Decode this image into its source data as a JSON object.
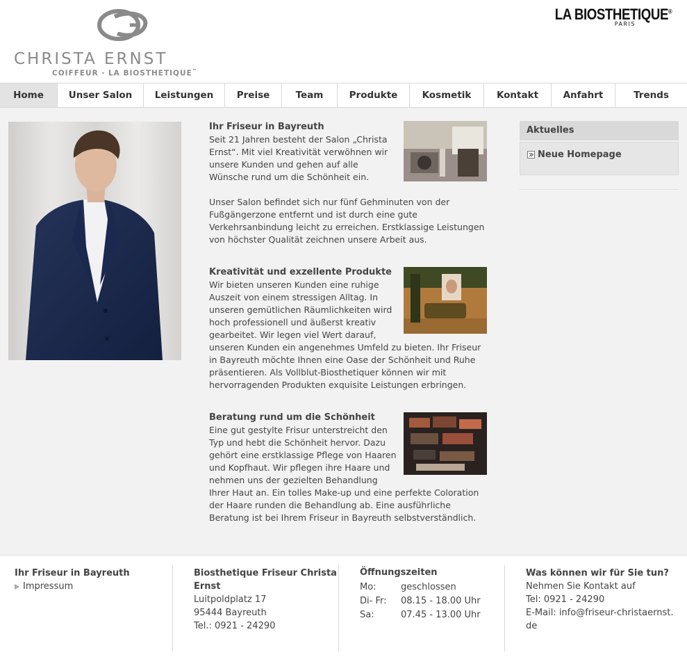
{
  "header": {
    "logo_name": "CHRISTA ERNST",
    "logo_sub": "COIFFEUR · LA BIOSTHETIQUE",
    "logo_sub_mark": "™",
    "brand_name": "LA BIOSTHETIQUE",
    "brand_mark": "®",
    "brand_city": "PARIS"
  },
  "nav": {
    "items": [
      {
        "label": "Home",
        "active": true
      },
      {
        "label": "Unser Salon"
      },
      {
        "label": "Leistungen"
      },
      {
        "label": "Preise"
      },
      {
        "label": "Team"
      },
      {
        "label": "Produkte"
      },
      {
        "label": "Kosmetik"
      },
      {
        "label": "Kontakt"
      },
      {
        "label": "Anfahrt"
      },
      {
        "label": "Trends"
      }
    ]
  },
  "content": {
    "s1_title": "Ihr Friseur in Bayreuth",
    "s1_p1": "Seit 21 Jahren besteht der Salon „Christa Ernst“. Mit viel Kreativität verwöhnen wir unsere Kunden und gehen auf alle Wünsche rund um die Schönheit ein.",
    "s1_p2": "Unser Salon befindet sich nur fünf Gehminuten von der Fußgängerzone entfernt und ist durch eine gute Verkehrsanbindung leicht zu erreichen. Erstklassige Leistungen von höchster Qualität zeichnen unsere Arbeit aus.",
    "s2_title": "Kreativität und exzellente Produkte",
    "s2_p1": "Wir bieten unseren Kunden eine ruhige Auszeit von einem stressigen Alltag. In unseren gemütlichen Räumlichkeiten wird hoch professionell und äußerst kreativ gearbeitet. Wir legen viel Wert darauf, unseren Kunden ein angenehmes Umfeld zu bieten. Ihr Friseur in Bayreuth möchte Ihnen eine Oase der Schönheit und Ruhe präsentieren. Als Vollblut-Biosthetiquer können wir mit hervorragenden Produkten exquisite Leistungen erbringen.",
    "s3_title": "Beratung rund um die Schönheit",
    "s3_p1": "Eine gut gestylte Frisur unterstreicht den Typ und hebt die Schönheit hervor. Dazu gehört eine erstklassige Pflege von Haaren und Kopfhaut. Wir pflegen ihre Haare und nehmen uns der gezielten Behandlung Ihrer Haut an. Ein tolles Make-up und eine perfekte Coloration der Haare runden die Behandlung ab. Eine ausführliche Beratung ist bei Ihrem Friseur in Bayreuth selbstverständlich."
  },
  "sidebar": {
    "title": "Aktuelles",
    "link": "Neue Homepage"
  },
  "footer": {
    "c1_title": "Ihr Friseur in Bayreuth",
    "c1_link": "Impressum",
    "c2_title": "Biosthetique Friseur Christa Ernst",
    "c2_street": "Luitpoldplatz 17",
    "c2_city": "95444 Bayreuth",
    "c2_phone": "Tel.: 0921 - 24290",
    "c3_title": "Öffnungszeiten",
    "hours": [
      {
        "day": "Mo:",
        "time": "geschlossen"
      },
      {
        "day": "Di- Fr:",
        "time": "08.15 - 18.00 Uhr"
      },
      {
        "day": "Sa:",
        "time": "07.45 - 13.00 Uhr"
      }
    ],
    "c4_title": "Was können wir für Sie tun?",
    "c4_l1": "Nehmen Sie Kontakt auf",
    "c4_l2": "Tel: 0921 - 24290",
    "c4_l3": "E-Mail: info@friseur-christaernst.de"
  }
}
